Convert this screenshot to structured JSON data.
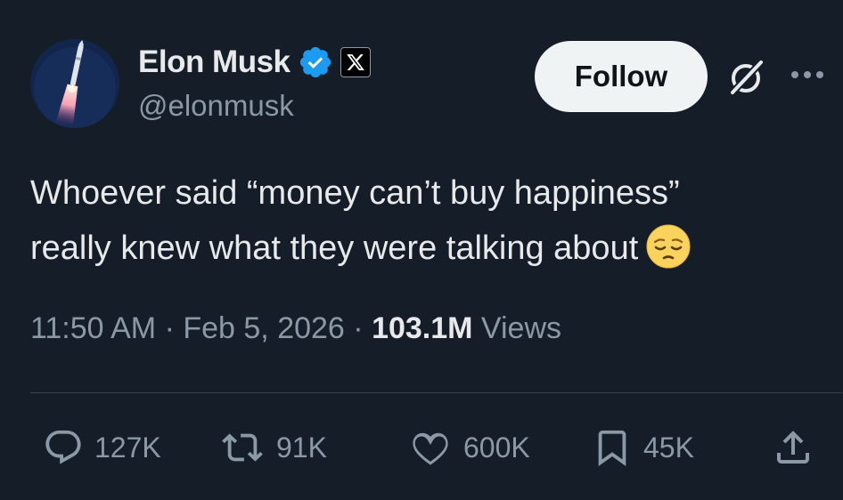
{
  "author": {
    "display_name": "Elon Musk",
    "handle": "@elonmusk",
    "verified_color": "#1d9bf0",
    "affiliate_badge_icon": "x-logo-icon",
    "avatar_icon": "rocket-launch-avatar"
  },
  "header": {
    "follow_label": "Follow",
    "grok_icon": "grok-icon",
    "more_icon": "more-icon"
  },
  "tweet": {
    "line1": "Whoever said “money can’t buy happiness”",
    "line2": "really knew what they were talking about",
    "emoji": "pensive-face-emoji"
  },
  "meta": {
    "time": "11:50 AM",
    "separator1": " · ",
    "date": "Feb 5, 2026",
    "separator2": " · ",
    "views_count": "103.1M",
    "views_label": " Views"
  },
  "actions": {
    "replies": "127K",
    "reposts": "91K",
    "likes": "600K",
    "bookmarks": "45K",
    "share_icon": "share-icon"
  },
  "colors": {
    "background": "#151d28",
    "text_primary": "#e7e9ea",
    "text_secondary": "#8b98a5",
    "divider": "#38444d",
    "follow_button_bg": "#eff3f4"
  }
}
